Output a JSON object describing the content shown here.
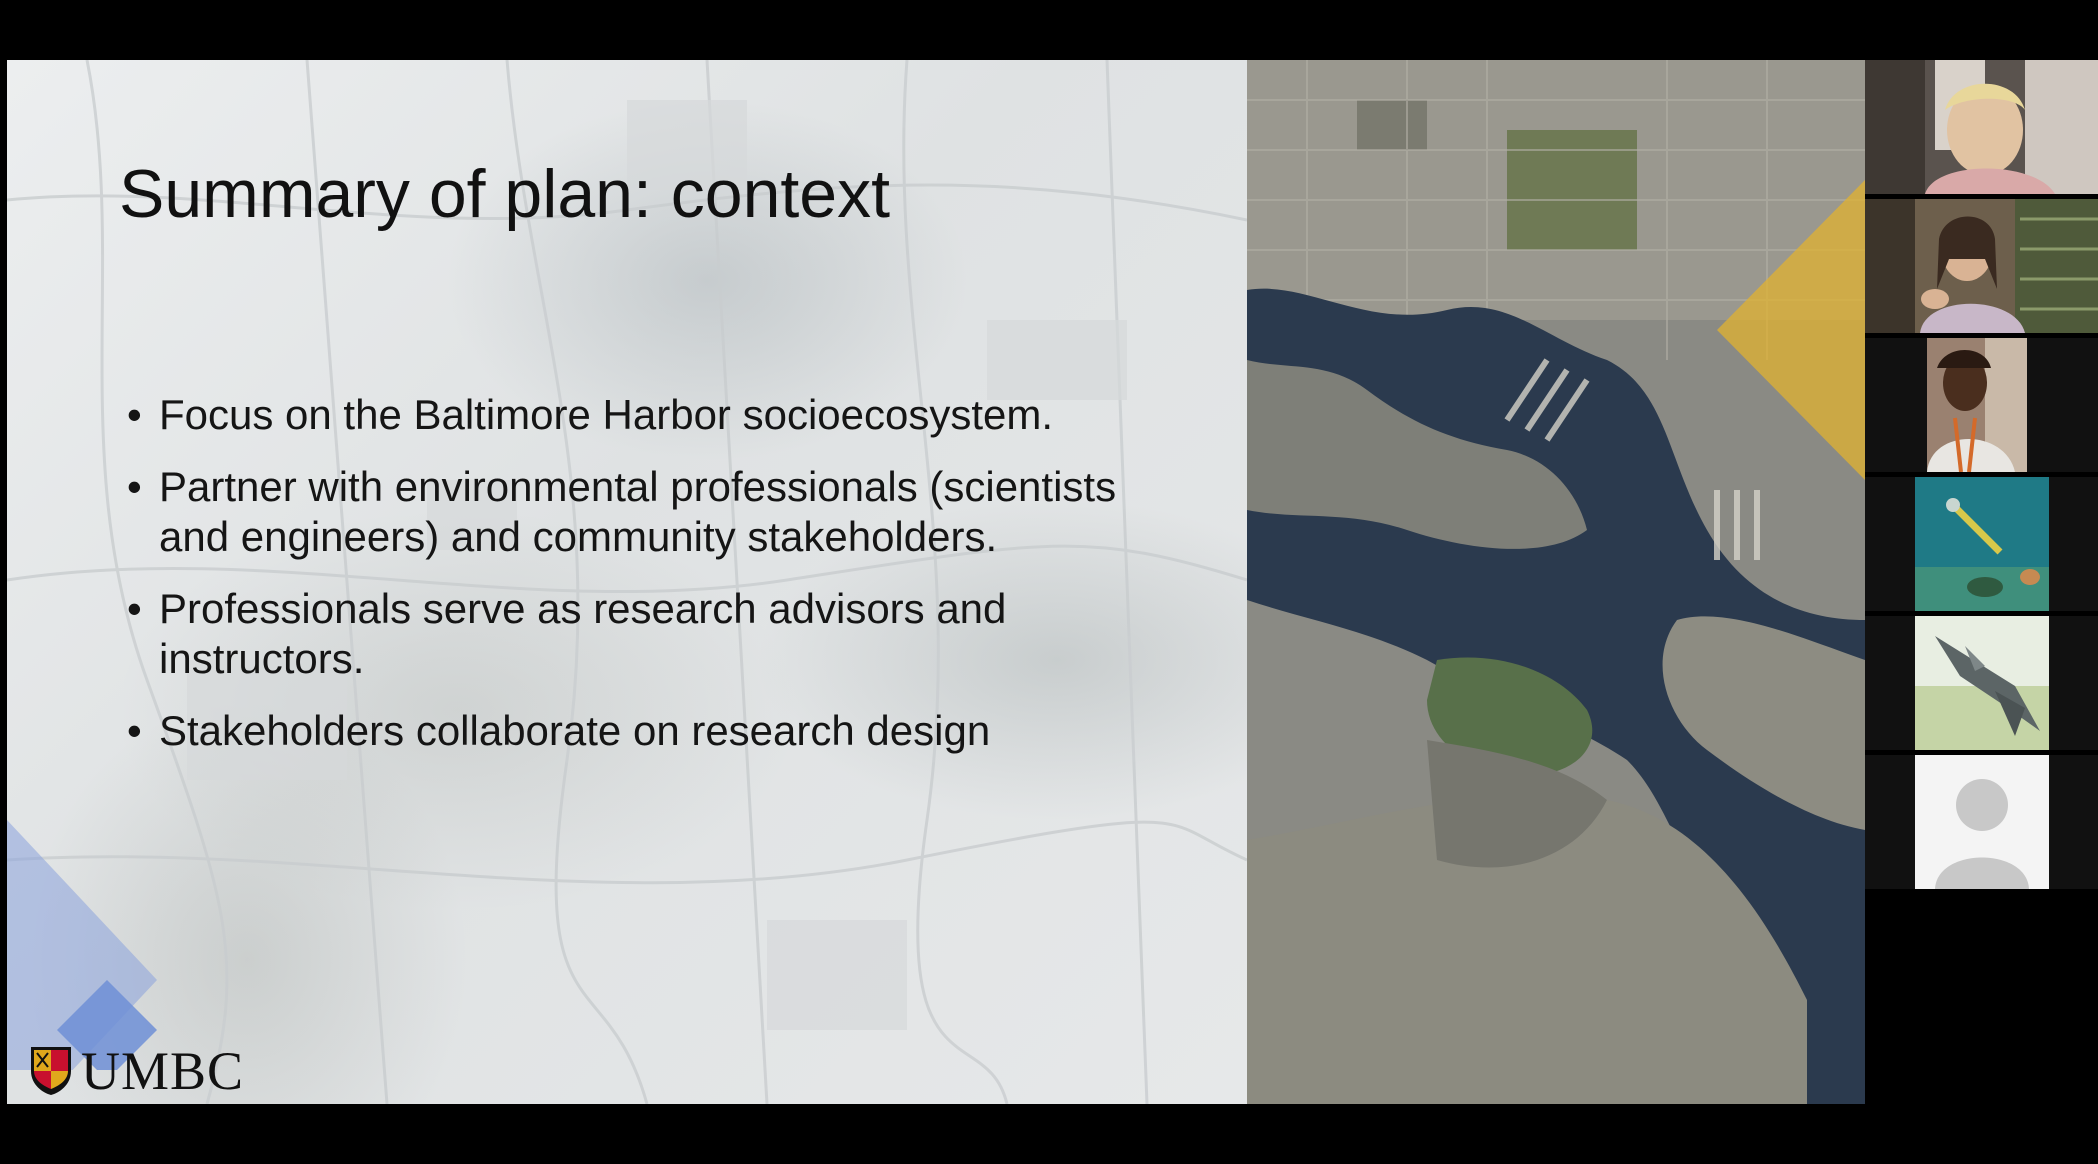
{
  "slide": {
    "title": "Summary of plan: context",
    "bullets": [
      {
        "text": "Focus on the Baltimore Harbor socioecosystem."
      },
      {
        "text": "Partner with environmental professionals (scientists and engineers) and community stakeholders."
      },
      {
        "text": "Professionals serve as research advisors and instructors."
      },
      {
        "text": "Stakeholders collaborate on research design"
      }
    ],
    "bullet_glyph": "•",
    "logo_text": "UMBC",
    "colors": {
      "background": "#e7e9ec",
      "accent_blue": "#6f8fd6",
      "accent_gold": "#e0b130",
      "water": "#2b3a4e"
    }
  },
  "gallery": {
    "participants": [
      {
        "video": "video-on"
      },
      {
        "video": "video-on"
      },
      {
        "video": "video-on"
      },
      {
        "video": "profile-picture-underwater"
      },
      {
        "video": "profile-picture-jet"
      },
      {
        "video": "avatar-placeholder"
      }
    ]
  }
}
